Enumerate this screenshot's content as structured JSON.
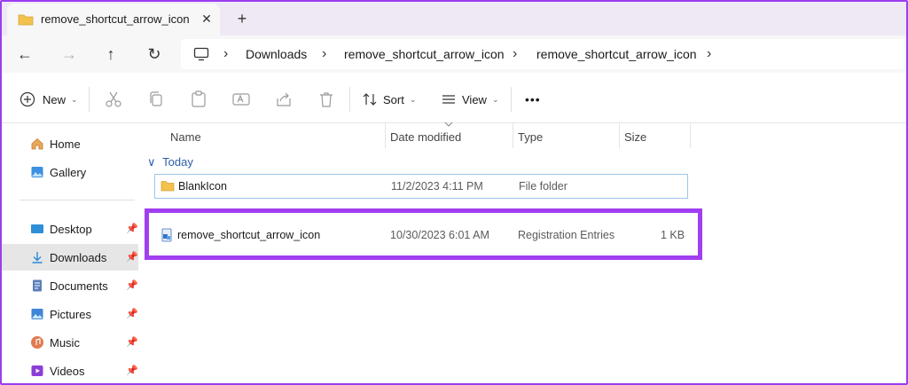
{
  "tab": {
    "title": "remove_shortcut_arrow_icon",
    "close": "✕",
    "new_tab": "+"
  },
  "nav": {
    "back": "←",
    "forward": "→",
    "up": "↑",
    "refresh": "↻",
    "more": "›"
  },
  "breadcrumbs": [
    "Downloads",
    "remove_shortcut_arrow_icon",
    "remove_shortcut_arrow_icon"
  ],
  "toolbar": {
    "new_label": "New",
    "sort_label": "Sort",
    "view_label": "View",
    "more_label": "•••",
    "icons": [
      "cut-icon",
      "copy-icon",
      "paste-icon",
      "rename-icon",
      "share-icon",
      "delete-icon"
    ]
  },
  "sidebar": {
    "top": [
      {
        "label": "Home",
        "icon": "home-icon"
      },
      {
        "label": "Gallery",
        "icon": "gallery-icon"
      }
    ],
    "pinned": [
      {
        "label": "Desktop",
        "icon": "desktop-icon",
        "active": false
      },
      {
        "label": "Downloads",
        "icon": "downloads-icon",
        "active": true
      },
      {
        "label": "Documents",
        "icon": "documents-icon",
        "active": false
      },
      {
        "label": "Pictures",
        "icon": "pictures-icon",
        "active": false
      },
      {
        "label": "Music",
        "icon": "music-icon",
        "active": false
      },
      {
        "label": "Videos",
        "icon": "videos-icon",
        "active": false
      }
    ],
    "pin_glyph": "📌"
  },
  "columns": {
    "name": "Name",
    "date": "Date modified",
    "type": "Type",
    "size": "Size"
  },
  "group": {
    "label": "Today",
    "chevron": "∨"
  },
  "files": [
    {
      "name": "BlankIcon",
      "date": "11/2/2023 4:11 PM",
      "type": "File folder",
      "size": "",
      "icon": "folder-icon"
    },
    {
      "name": "remove_shortcut_arrow_icon",
      "date": "10/30/2023 6:01 AM",
      "type": "Registration Entries",
      "size": "1 KB",
      "icon": "registry-file-icon"
    }
  ],
  "colors": {
    "highlight": "#a13ff0",
    "accent": "#2b5ea7",
    "folder": "#f2c14e"
  }
}
